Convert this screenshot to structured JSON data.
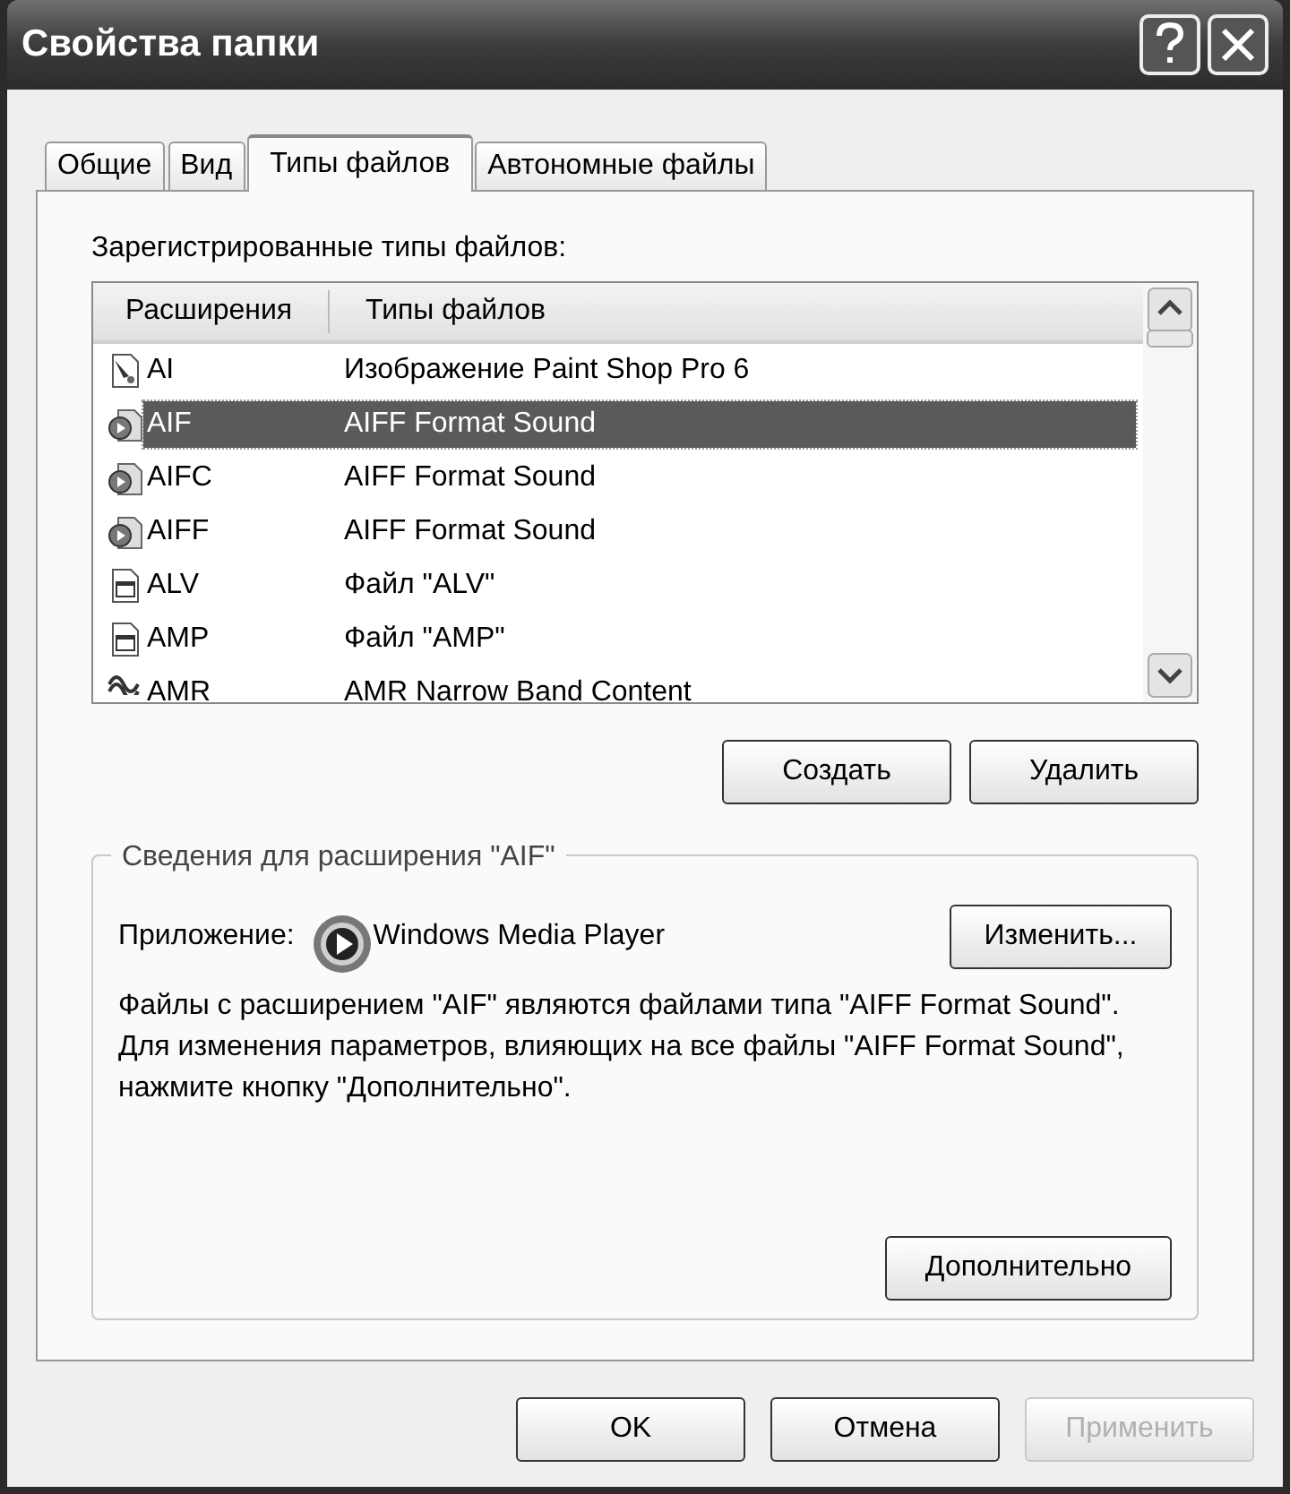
{
  "window": {
    "title": "Свойства папки"
  },
  "tabs": [
    {
      "label": "Общие",
      "selected": false
    },
    {
      "label": "Вид",
      "selected": false
    },
    {
      "label": "Типы файлов",
      "selected": true
    },
    {
      "label": "Автономные файлы",
      "selected": false
    }
  ],
  "registered_label": "Зарегистрированные типы файлов:",
  "table": {
    "columns": [
      "Расширения",
      "Типы файлов"
    ],
    "rows": [
      {
        "extension": "AI",
        "type": "Изображение Paint Shop Pro 6",
        "kind": "image",
        "selected": false
      },
      {
        "extension": "AIF",
        "type": "AIFF Format Sound",
        "kind": "sound",
        "selected": true
      },
      {
        "extension": "AIFC",
        "type": "AIFF Format Sound",
        "kind": "sound",
        "selected": false
      },
      {
        "extension": "AIFF",
        "type": "AIFF Format Sound",
        "kind": "sound",
        "selected": false
      },
      {
        "extension": "ALV",
        "type": "Файл \"ALV\"",
        "kind": "window",
        "selected": false
      },
      {
        "extension": "AMP",
        "type": "Файл \"AMP\"",
        "kind": "window",
        "selected": false
      },
      {
        "extension": "AMR",
        "type": "AMR Narrow Band Content",
        "kind": "wave",
        "selected": false
      }
    ]
  },
  "list_buttons": [
    {
      "label": "Создать"
    },
    {
      "label": "Удалить"
    }
  ],
  "details": {
    "title": "Сведения для расширения \"AIF\"",
    "app_label": "Приложение:",
    "app_name": "Windows Media Player",
    "change_button": "Изменить...",
    "description": "Файлы с расширением \"AIF\" являются файлами типа \"AIFF Format Sound\". Для изменения параметров, влияющих на все файлы \"AIFF Format Sound\", нажмите кнопку \"Дополнительно\".",
    "advanced_button": "Дополнительно"
  },
  "footer_buttons": [
    {
      "label": "OK",
      "disabled": false
    },
    {
      "label": "Отмена",
      "disabled": false
    },
    {
      "label": "Применить",
      "disabled": true
    }
  ]
}
